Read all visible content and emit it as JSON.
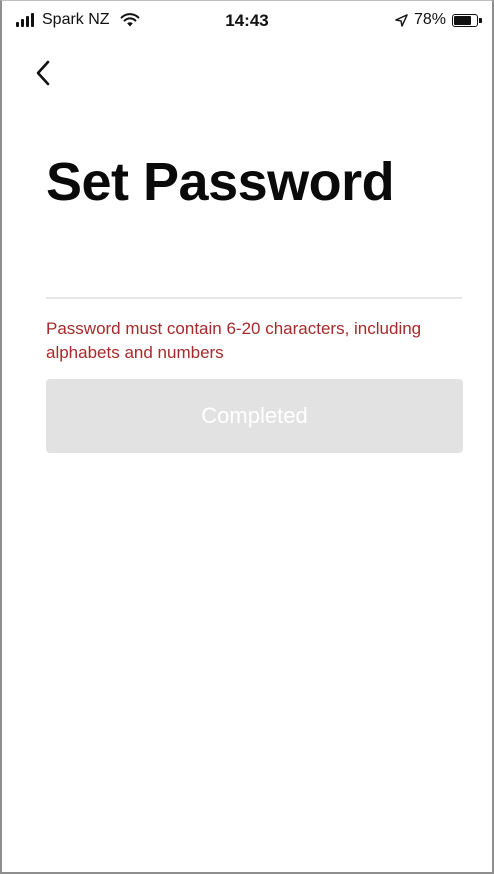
{
  "status_bar": {
    "carrier": "Spark NZ",
    "time": "14:43",
    "battery": "78%",
    "battery_level": 0.78
  },
  "nav": {
    "back_icon": "chevron-left-icon"
  },
  "page": {
    "title": "Set Password"
  },
  "form": {
    "password_value": "",
    "error_message": "Password must contain 6-20 characters, including alphabets and numbers",
    "submit_label": "Completed",
    "submit_enabled": false
  },
  "colors": {
    "error": "#a52a2a",
    "button_disabled_bg": "#e2e2e2",
    "button_text": "#ffffff"
  }
}
